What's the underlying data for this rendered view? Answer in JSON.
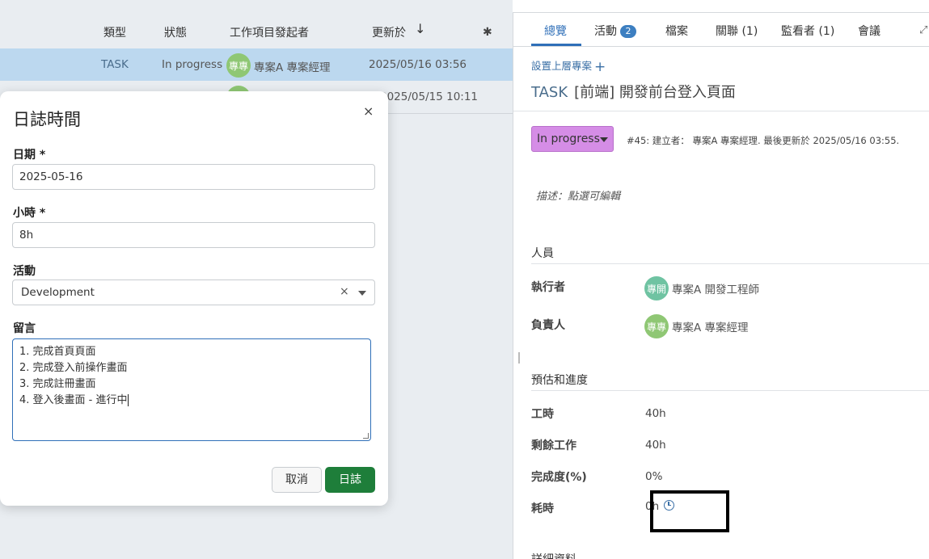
{
  "table": {
    "headers": {
      "type": "類型",
      "status": "狀態",
      "creator": "工作項目發起者",
      "updated": "更新於",
      "sort_arrow": "↓"
    },
    "rows": [
      {
        "type": "TASK",
        "status": "In progress",
        "avatar": "專專",
        "creator": "專案A 專案經理",
        "updated": "2025/05/16 03:56"
      },
      {
        "updated": "2025/05/15 10:11"
      }
    ]
  },
  "modal": {
    "title": "日誌時間",
    "close": "×",
    "date_label": "日期 *",
    "date_value": "2025-05-16",
    "hours_label": "小時 *",
    "hours_value": "8h",
    "activity_label": "活動",
    "activity_value": "Development",
    "clear": "×",
    "comment_label": "留言",
    "comment_lines": [
      "1. 完成首頁頁面",
      "2. 完成登入前操作畫面",
      "3. 完成註冊畫面",
      "4. 登入後畫面 - 進行中"
    ],
    "cancel_label": "取消",
    "submit_label": "日誌"
  },
  "panel": {
    "tabs": {
      "overview": "總覽",
      "activity": "活動",
      "activity_count": "2",
      "files": "檔案",
      "relations": "關聯 (1)",
      "watchers": "監看者 (1)",
      "meetings": "會議"
    },
    "set_parent": "設置上層專案",
    "task_type": "TASK",
    "task_title": "[前端] 開發前台登入頁面",
    "status": "In progress",
    "meta": "#45: 建立者： 專案A 專案經理. 最後更新於 2025/05/16 03:55.",
    "description_placeholder": "描述：點選可編輯",
    "people_section": "人員",
    "assignee_label": "執行者",
    "assignee_avatar": "專開",
    "assignee_name": "專案A 開發工程師",
    "accountable_label": "負責人",
    "accountable_avatar": "專專",
    "accountable_name": "專案A 專案經理",
    "estimates_section": "預估和進度",
    "work_label": "工時",
    "work_value": "40h",
    "remaining_label": "剩餘工作",
    "remaining_value": "40h",
    "progress_label": "完成度(%)",
    "progress_value": "0%",
    "spent_label": "耗時",
    "spent_value": "0h",
    "details_section": "詳細資料"
  },
  "colors": {
    "accent": "#2f6fb8",
    "status_in_progress": "#d58de6",
    "submit_button": "#1e7e3a",
    "selected_row": "#bcd8ef"
  }
}
